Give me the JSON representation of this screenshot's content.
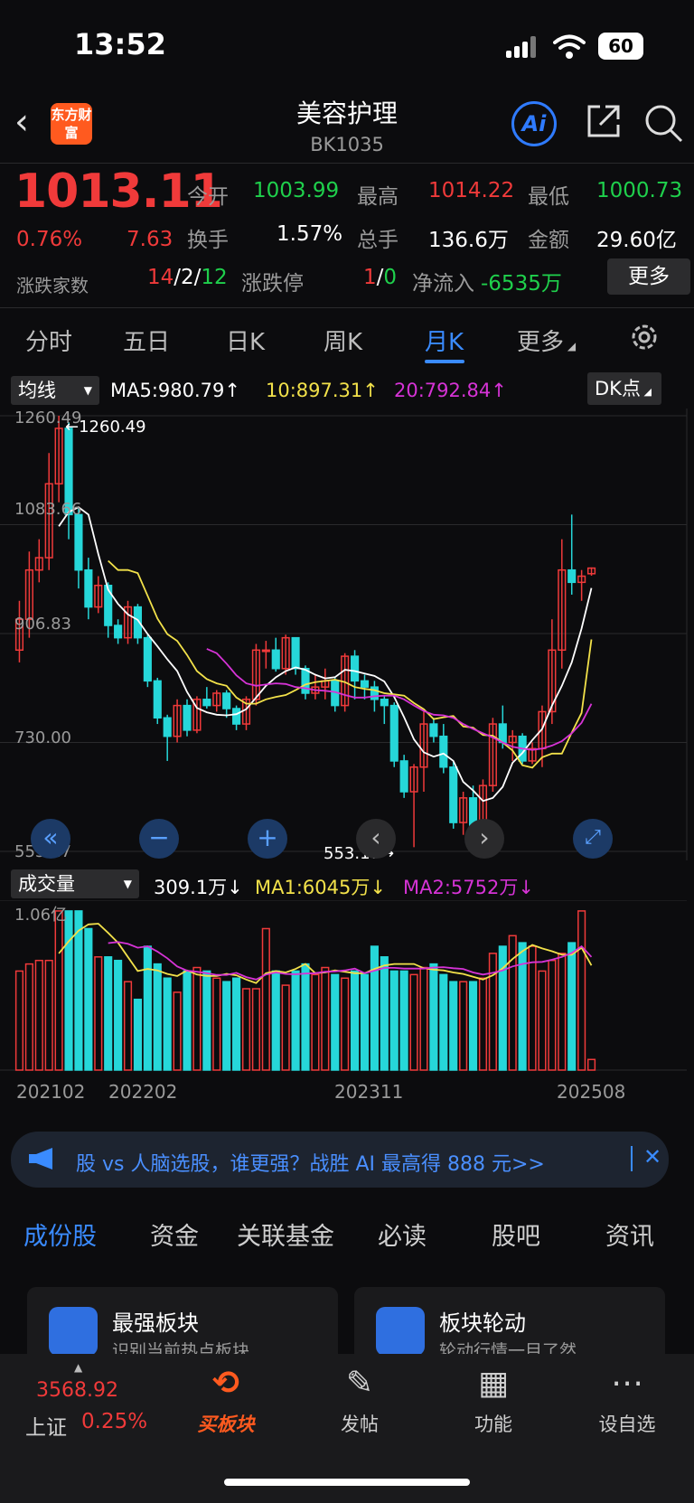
{
  "status": {
    "time": "13:52",
    "battery": "60"
  },
  "header": {
    "title": "美容护理",
    "code": "BK1035",
    "logo_text": "东方财富",
    "ai_label": "Ai"
  },
  "quote": {
    "price": "1013.11",
    "change_pct": "0.76%",
    "change": "7.63",
    "open_label": "今开",
    "open": "1003.99",
    "high_label": "最高",
    "high": "1014.22",
    "low_label": "最低",
    "low": "1000.73",
    "turnover_label": "换手",
    "turnover": "1.57%",
    "volume_label": "总手",
    "volume": "136.6万",
    "amount_label": "金额",
    "amount": "29.60亿",
    "updown_label": "涨跌家数",
    "up": "14",
    "flat": "2",
    "down": "12",
    "limit_label": "涨跌停",
    "limit_up": "1",
    "limit_down": "0",
    "netflow_label": "净流入",
    "netflow": "-6535万",
    "more_label": "更多"
  },
  "ktabs": [
    "分时",
    "五日",
    "日K",
    "周K",
    "月K",
    "更多"
  ],
  "ma_bar": {
    "select": "均线",
    "ma5": "MA5:980.79↑",
    "ma10": "10:897.31↑",
    "ma20": "20:792.84↑",
    "dk": "DK点"
  },
  "price_axis": {
    "high": "1260.49",
    "l2": "1083.66",
    "l3": "906.83",
    "l4": "730.00",
    "low": "553.17",
    "high_mark": "1260.49",
    "low_mark": "553.17"
  },
  "vol_bar": {
    "select": "成交量",
    "vol": "309.1万↓",
    "ma1": "MA1:6045万↓",
    "ma2": "MA2:5752万↓",
    "max": "1.06亿"
  },
  "dates": {
    "d1": "202102",
    "d2": "202202",
    "d3": "202311",
    "d4": "202508"
  },
  "banner": {
    "text": "股 vs 人脑选股，谁更强？战胜 AI 最高得 888 元>>",
    "close": "✕"
  },
  "btabs": [
    "成份股",
    "资金",
    "关联基金",
    "必读",
    "股吧",
    "资讯"
  ],
  "cards": [
    {
      "title": "最强板块",
      "sub": "识别当前热点板块"
    },
    {
      "title": "板块轮动",
      "sub": "轮动行情一目了然"
    }
  ],
  "index": {
    "value": "3568.92",
    "name": "上证",
    "pct": "0.25%"
  },
  "nav": [
    {
      "label": "买板块",
      "icon": "buy-sector-icon"
    },
    {
      "label": "发帖",
      "icon": "edit-icon"
    },
    {
      "label": "功能",
      "icon": "grid-icon"
    },
    {
      "label": "设自选",
      "icon": "more-circle-icon"
    }
  ],
  "colors": {
    "up": "#f03a3a",
    "down": "#1fd04c",
    "accent": "#3a8bff",
    "candle_down": "#26d7d9"
  },
  "chart_data": {
    "type": "candlestick",
    "title": "美容护理 月K",
    "ylim": [
      553.17,
      1260.49
    ],
    "candles": [
      [
        880,
        930,
        860,
        960
      ],
      [
        930,
        1010,
        900,
        1040
      ],
      [
        1010,
        1030,
        990,
        1060
      ],
      [
        1030,
        1150,
        1010,
        1200
      ],
      [
        1150,
        1240,
        1120,
        1260.49
      ],
      [
        1240,
        1100,
        1060,
        1250
      ],
      [
        1100,
        1010,
        980,
        1110
      ],
      [
        1010,
        950,
        930,
        1030
      ],
      [
        950,
        985,
        940,
        1000
      ],
      [
        985,
        920,
        900,
        990
      ],
      [
        920,
        900,
        890,
        930
      ],
      [
        900,
        950,
        890,
        960
      ],
      [
        950,
        900,
        890,
        955
      ],
      [
        900,
        830,
        820,
        905
      ],
      [
        830,
        770,
        760,
        835
      ],
      [
        770,
        740,
        700,
        775
      ],
      [
        740,
        790,
        730,
        800
      ],
      [
        790,
        750,
        740,
        800
      ],
      [
        750,
        800,
        745,
        805
      ],
      [
        800,
        790,
        785,
        820
      ],
      [
        790,
        810,
        780,
        815
      ],
      [
        810,
        785,
        770,
        815
      ],
      [
        785,
        760,
        750,
        790
      ],
      [
        760,
        800,
        750,
        805
      ],
      [
        800,
        880,
        790,
        890
      ],
      [
        880,
        880,
        850,
        895
      ],
      [
        880,
        850,
        845,
        900
      ],
      [
        850,
        900,
        840,
        905
      ],
      [
        900,
        850,
        840,
        900
      ],
      [
        850,
        810,
        800,
        855
      ],
      [
        810,
        820,
        800,
        840
      ],
      [
        820,
        830,
        800,
        850
      ],
      [
        830,
        790,
        780,
        835
      ],
      [
        790,
        870,
        780,
        875
      ],
      [
        870,
        830,
        800,
        880
      ],
      [
        830,
        820,
        800,
        840
      ],
      [
        820,
        800,
        780,
        830
      ],
      [
        800,
        790,
        760,
        805
      ],
      [
        790,
        700,
        690,
        795
      ],
      [
        700,
        650,
        640,
        710
      ],
      [
        650,
        690,
        560,
        695
      ],
      [
        690,
        760,
        650,
        780
      ],
      [
        760,
        740,
        730,
        770
      ],
      [
        740,
        690,
        680,
        760
      ],
      [
        690,
        600,
        590,
        700
      ],
      [
        600,
        640,
        580,
        650
      ],
      [
        640,
        590,
        570,
        660
      ],
      [
        590,
        660,
        570,
        670
      ],
      [
        660,
        760,
        650,
        770
      ],
      [
        760,
        730,
        720,
        790
      ],
      [
        730,
        740,
        700,
        750
      ],
      [
        740,
        700,
        695,
        745
      ],
      [
        700,
        720,
        695,
        730
      ],
      [
        720,
        780,
        690,
        790
      ],
      [
        780,
        880,
        760,
        930
      ],
      [
        880,
        1010,
        850,
        1060
      ],
      [
        1010,
        990,
        970,
        1100
      ],
      [
        990,
        1000,
        960,
        1010
      ],
      [
        1003.99,
        1013.11,
        1000.73,
        1014.22
      ]
    ],
    "ma5": [
      null,
      null,
      null,
      null,
      1081,
      1104,
      1112,
      1100,
      1036,
      978,
      955,
      938,
      929,
      906,
      886,
      865,
      846,
      812,
      786,
      779,
      775,
      774,
      776,
      784,
      803,
      822,
      836,
      846,
      852,
      848,
      840,
      834,
      836,
      848,
      846,
      842,
      838,
      829,
      804,
      771,
      735,
      714,
      707,
      712,
      700,
      666,
      652,
      635,
      640,
      658,
      697,
      713,
      734,
      752,
      790,
      822,
      860,
      915,
      980.79
    ],
    "ma10": [
      null,
      null,
      null,
      null,
      null,
      null,
      null,
      null,
      null,
      1025,
      1010,
      1010,
      1005,
      968,
      931,
      906,
      895,
      872,
      846,
      833,
      826,
      822,
      803,
      793,
      793,
      800,
      804,
      807,
      815,
      824,
      828,
      830,
      832,
      828,
      820,
      817,
      815,
      810,
      808,
      806,
      794,
      784,
      768,
      771,
      773,
      756,
      754,
      742,
      741,
      730,
      717,
      693,
      689,
      706,
      712,
      712,
      746,
      778,
      897.31
    ],
    "ma20": [
      null,
      null,
      null,
      null,
      null,
      null,
      null,
      null,
      null,
      null,
      null,
      null,
      null,
      null,
      null,
      null,
      null,
      null,
      null,
      882,
      875,
      858,
      839,
      826,
      822,
      824,
      826,
      825,
      820,
      818,
      815,
      814,
      812,
      807,
      803,
      803,
      805,
      806,
      806,
      800,
      790,
      781,
      775,
      774,
      770,
      760,
      752,
      745,
      738,
      730,
      723,
      720,
      718,
      720,
      725,
      732,
      745,
      762,
      792.84
    ],
    "volume": [
      28,
      30,
      31,
      31,
      45,
      45,
      45,
      40,
      32,
      32,
      31,
      25,
      20,
      35,
      30,
      26,
      22,
      28,
      29,
      28,
      26,
      25,
      26,
      23,
      23,
      40,
      28,
      24,
      28,
      30,
      27,
      29,
      27,
      26,
      28,
      27,
      35,
      32,
      28,
      28,
      27,
      29,
      30,
      27,
      25,
      25,
      25,
      26,
      33,
      35,
      38,
      36,
      35,
      28,
      31,
      33,
      36,
      45,
      3
    ]
  }
}
